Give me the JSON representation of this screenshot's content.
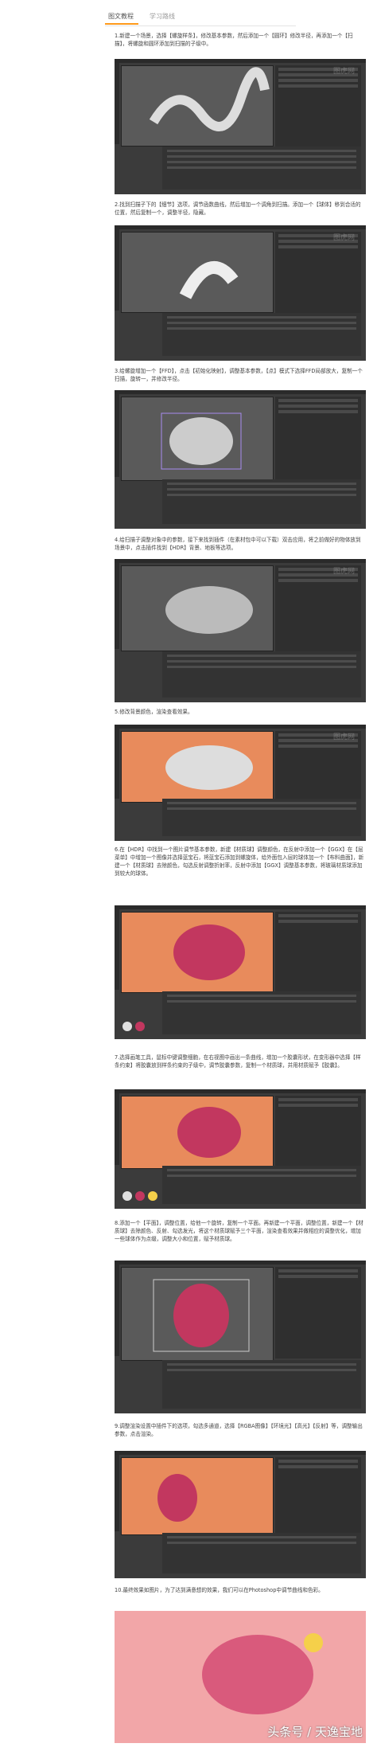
{
  "tabs": [
    "图文教程",
    "学习路线"
  ],
  "steps": [
    "1.新建一个场景，选择【螺旋样条】，修改基本参数，然后添加一个【圆环】修改半径，再添加一个【扫描】，将螺旋和圆环添加到扫描的子级中。",
    "2.找到扫描子下的【细节】选项，调节函数曲线，然后增加一个调角到扫描。添加一个【球体】移到合适的位置，然后复制一个，调整半径，隐藏。",
    "3.给螺旋增加一个【FFD】，点击【初始化映射】，调整基本参数，【点】模式下选择FFD局部放大，复制一个扫描，旋转一，并修改半径。",
    "4.给扫描子调整对象中的参数，接下来找到插件（在素材包中可以下载）双击应用，将之前做好的物体放到场景中，点击插件找到【HDR】背景、地板等选项。",
    "5.修改背景颜色，渲染查看效果。",
    "6.在【HDR】中找到一个图片调节基本参数，新建【材质球】调整颜色，在反射中添加一个【GGX】在【层菜单】中增加一个图像并选择蓝宝石，将蓝宝石添加到螺旋体，给外面包入层的球体加一个【布料曲面】，新建一个【材质球】去除颜色，勾选反射调整折射率，反射中添加【GGX】调整基本参数，将玻璃材质球添加到较大的球体。",
    "7.选择画笔工具，鼠标中键调整细胞，在右视图中画出一条曲线，增加一个胶囊形状，在变形器中选择【样条约束】将胶囊放到样条约束的子级中，调节胶囊参数，复制一个材质球，并用材质赋予【胶囊】。",
    "8.添加一个【平面】，调整位置，给他一个旋转，复制一个平面。再新建一个平面，调整位置，新建一个【材质球】去除颜色、反射、勾选发光，将这个材质球赋予三个平面，渲染查看效果并做相应的调整优化，增加一些球体作为点缀，调整大小和位置，赋予材质球。",
    "9.调整渲染设置中插件下的选项，勾选多通道，选择【RGBA图像】【环境光】【高光】【反射】等，调整输出参数，点击渲染。",
    "10.最终效果如图片，为了达到满意想的效果，我们可以在Photoshop中调节曲线和色彩。"
  ],
  "watermark_text": "图虎网",
  "footer_text": "头条号 / 天逸宝地",
  "colors": {
    "accent": "#ff9a1a",
    "orange_bg": "#e88b5c",
    "dark_ui": "#3b3b3b",
    "pink": "#c2375f"
  }
}
